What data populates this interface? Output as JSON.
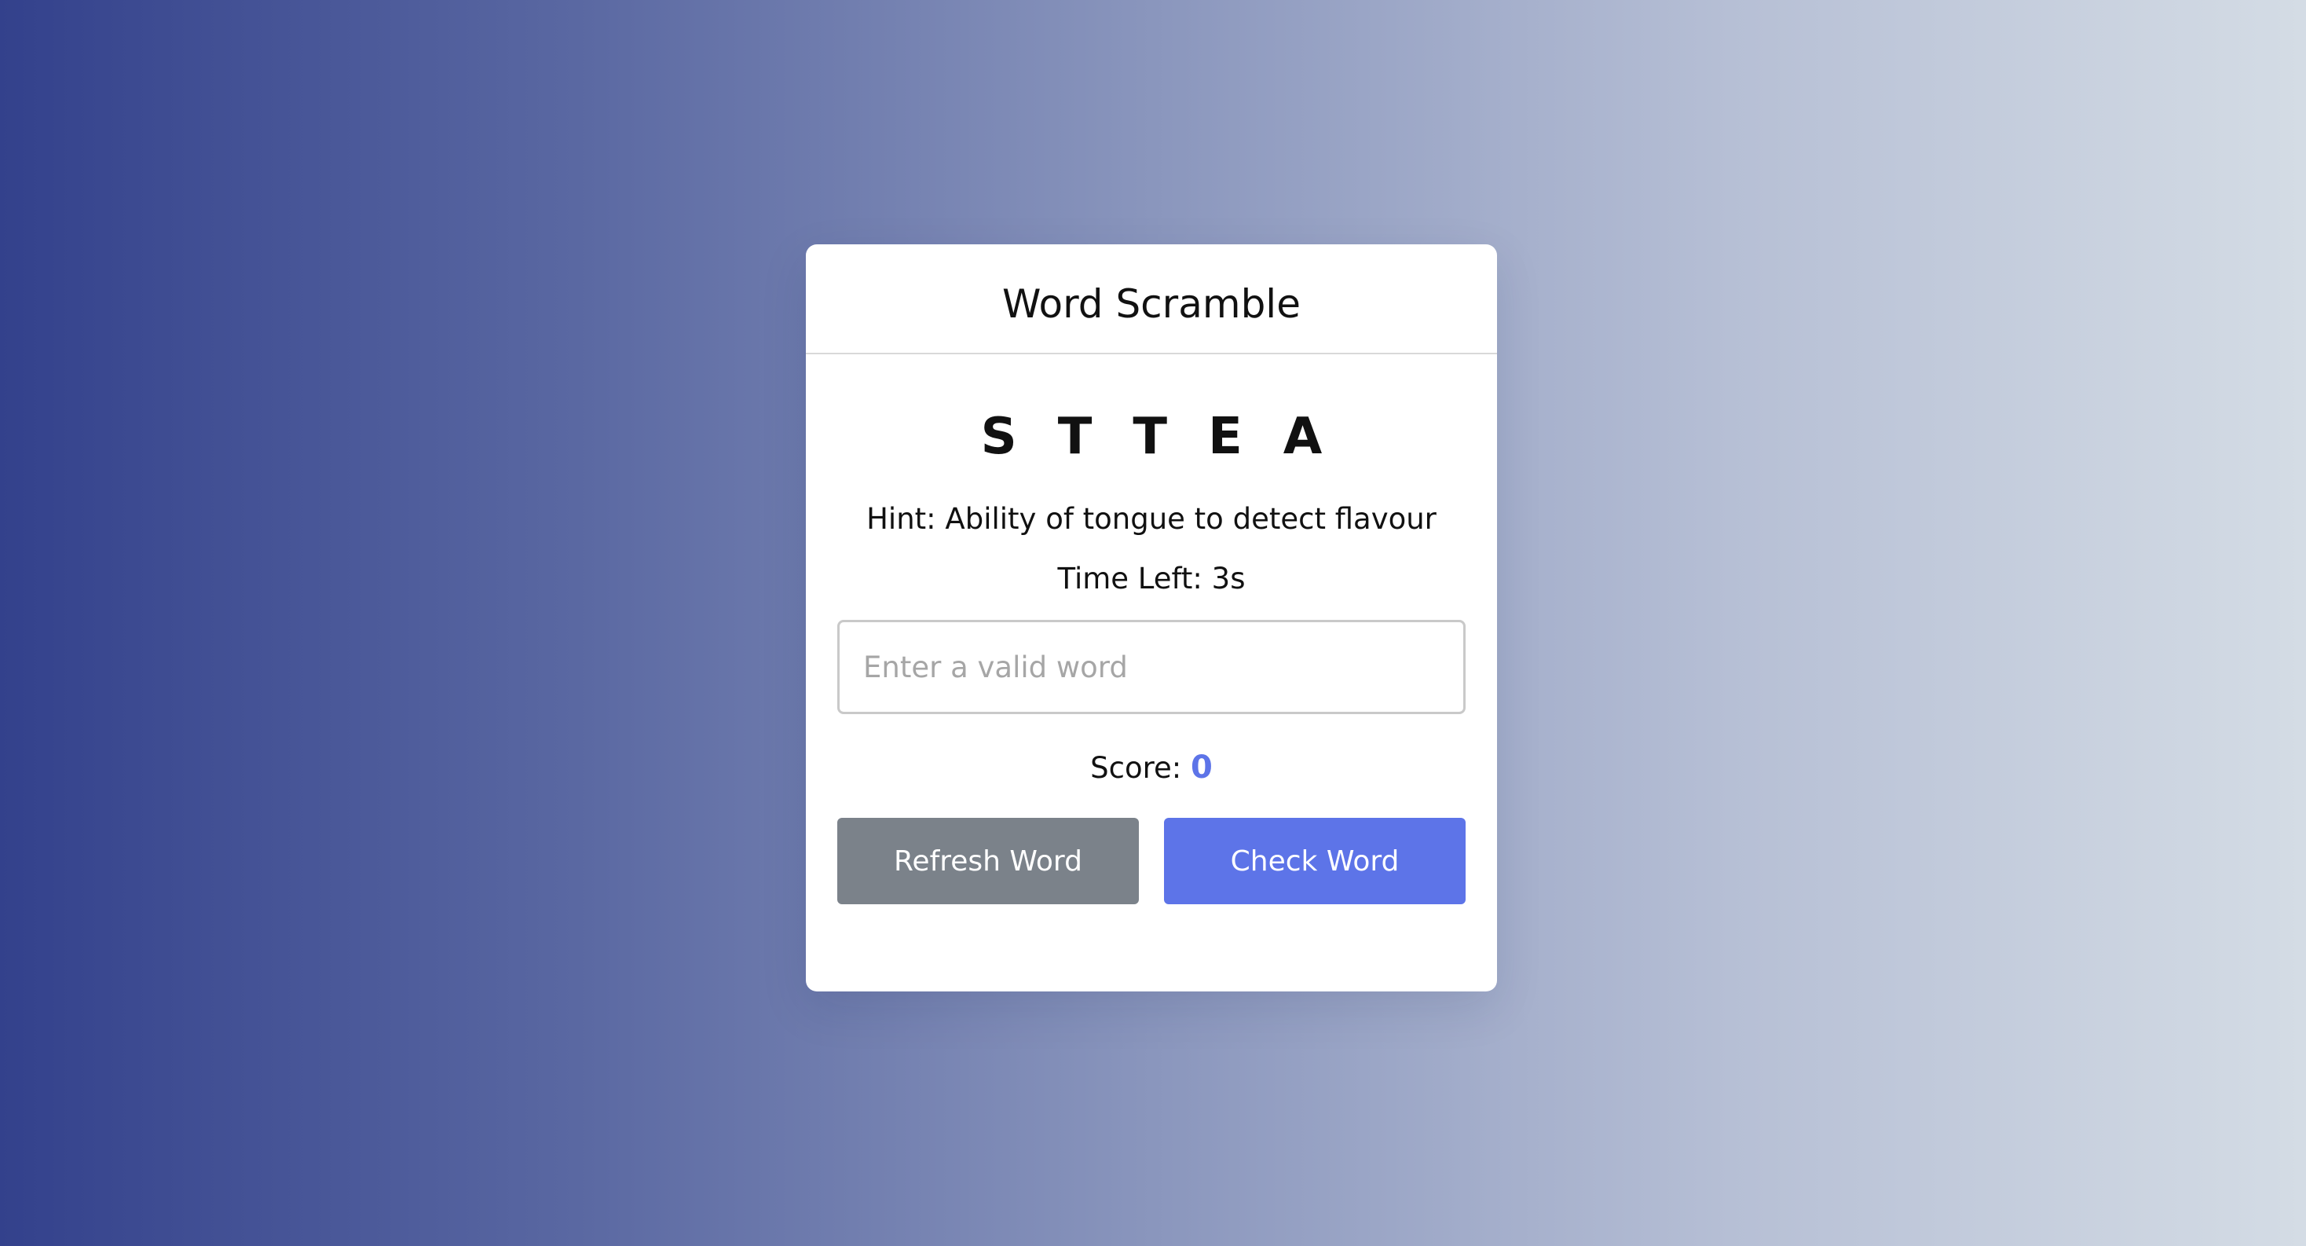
{
  "game": {
    "title": "Word Scramble",
    "letters": [
      "S",
      "T",
      "T",
      "E",
      "A"
    ],
    "hint_label": "Hint:",
    "hint_text": "Ability of tongue to detect flavour",
    "time_label": "Time Left:",
    "time_value": "3s",
    "input_placeholder": "Enter a valid word",
    "score_label": "Score:",
    "score_value": "0",
    "refresh_label": "Refresh Word",
    "check_label": "Check Word"
  },
  "colors": {
    "accent": "#5d74e8",
    "refresh_button": "#7b828a",
    "background_left": "#33418c",
    "background_right": "#d4dce5"
  }
}
